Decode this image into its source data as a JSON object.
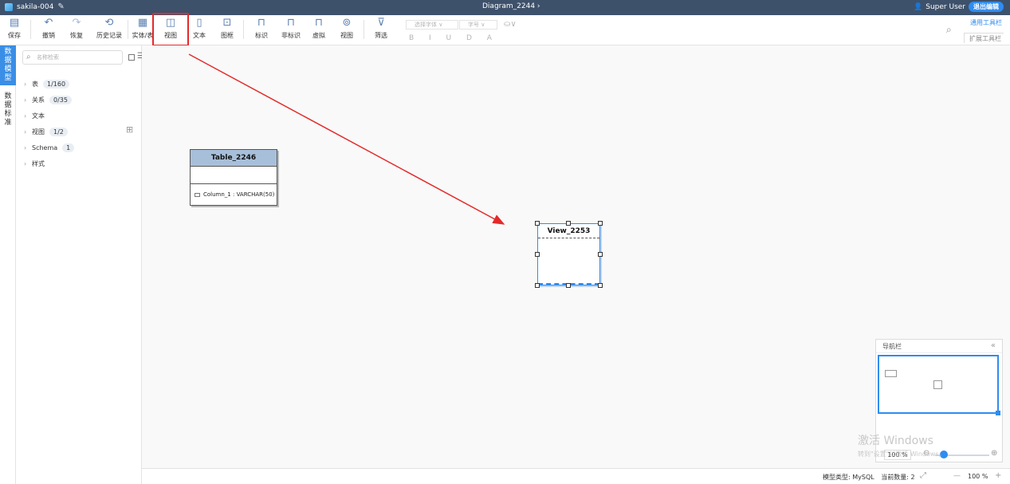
{
  "topbar": {
    "project_name": "sakila-004",
    "diagram_title": "Diagram_2244",
    "user_name": "Super User",
    "exit_edit": "退出编辑"
  },
  "toolbar": {
    "save": "保存",
    "undo": "撤销",
    "redo": "恢复",
    "history": "历史记录",
    "entity": "实体/表",
    "view": "视图",
    "text": "文本",
    "frame": "图框",
    "identifying": "标识",
    "non_identifying": "非标识",
    "virtual": "虚拟",
    "view_rel": "视图",
    "filter": "筛选",
    "font_select": "选择字体",
    "font_size": "字号",
    "format_glyphs": "B I U D A",
    "general_tools": "通用工具栏",
    "extended_tools": "扩展工具栏"
  },
  "vtabs": {
    "data_model": [
      "数",
      "据",
      "模",
      "型"
    ],
    "data_standard": [
      "数",
      "据",
      "标",
      "准"
    ]
  },
  "sidebar": {
    "search_placeholder": "名称检索",
    "tree": [
      {
        "label": "表",
        "badge": "1/160"
      },
      {
        "label": "关系",
        "badge": "0/35"
      },
      {
        "label": "文本",
        "badge": ""
      },
      {
        "label": "视图",
        "badge": "1/2"
      },
      {
        "label": "Schema",
        "badge": "1"
      },
      {
        "label": "样式",
        "badge": ""
      }
    ]
  },
  "canvas": {
    "table": {
      "name": "Table_2246",
      "column": "Column_1 : VARCHAR(50)"
    },
    "view": {
      "name": "View_2253"
    }
  },
  "navigator": {
    "title": "导航栏",
    "zoom": "100 %"
  },
  "watermark": {
    "line1": "激活 Windows",
    "line2": "转到\"设置\"以激活 Windows。"
  },
  "statusbar": {
    "model_type": "模型类型: MySQL",
    "current_count": "当前数量: 2",
    "zoom": "100 %"
  },
  "colors": {
    "topbar": "#3e516b",
    "accent": "#2f8cf0",
    "highlight": "#e42a2a",
    "entity_header": "#a8bfd9"
  }
}
